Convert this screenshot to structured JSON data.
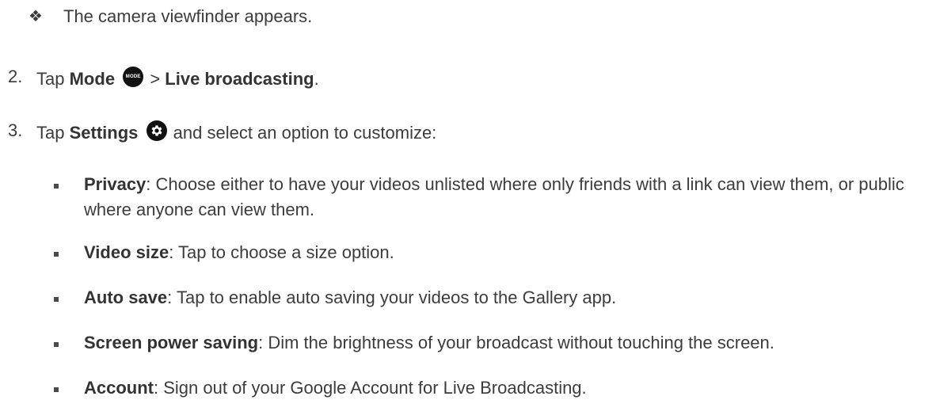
{
  "step1_note": "The camera viewfinder appears.",
  "step2": {
    "number": "2.",
    "tap": "Tap",
    "mode_label": "Mode",
    "mode_icon_text": "MODE",
    "separator": ">",
    "target": "Live broadcasting",
    "end": "."
  },
  "step3": {
    "number": "3.",
    "tap": "Tap",
    "settings_label": "Settings",
    "rest": "and select an option to customize:"
  },
  "options": [
    {
      "label": "Privacy",
      "desc": ": Choose either to have your videos unlisted where only friends with a link can view them, or public where anyone can view them."
    },
    {
      "label": "Video size",
      "desc": ": Tap to choose a size option."
    },
    {
      "label": "Auto save",
      "desc": ": Tap to enable auto saving your videos to the Gallery app."
    },
    {
      "label": "Screen power saving",
      "desc": ": Dim the brightness of your broadcast without touching the screen."
    },
    {
      "label": "Account",
      "desc": ": Sign out of your Google Account for Live Broadcasting."
    }
  ],
  "icons": {
    "diamond_bullet": "four-diamond-bullet-icon",
    "mode": "mode-button-icon",
    "settings": "gear-icon",
    "square_bullet": "square-bullet-icon"
  }
}
